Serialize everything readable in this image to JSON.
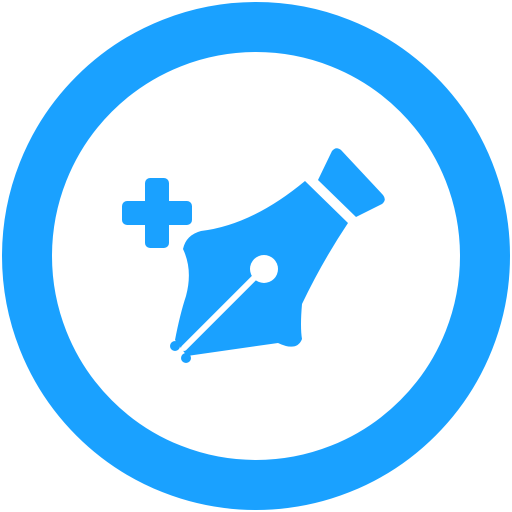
{
  "icon": {
    "name": "add-anchor-point-pen-icon",
    "parts": [
      "circle-ring",
      "plus-sign",
      "pen-nib",
      "nib-hole",
      "nib-slit"
    ],
    "colors": {
      "accent": "#1AA1FF",
      "background": "#FFFFFF"
    }
  }
}
